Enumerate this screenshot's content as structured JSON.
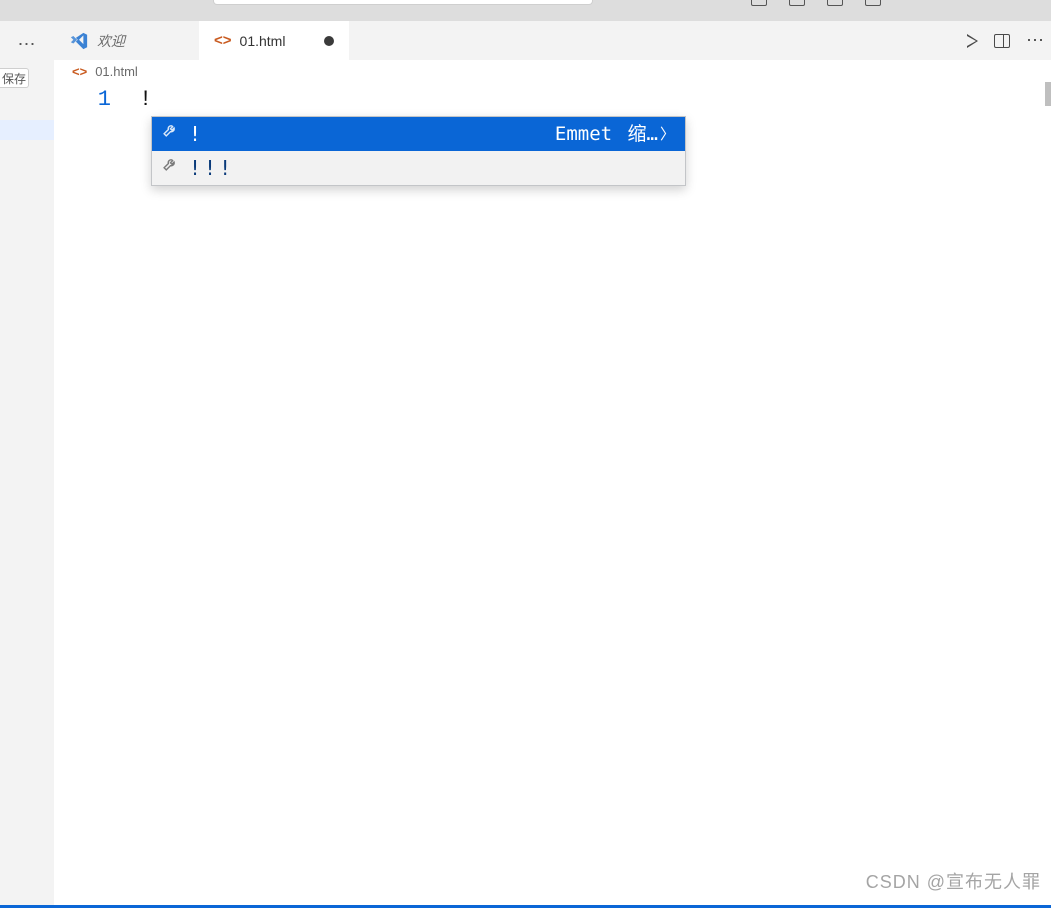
{
  "titlebar": {
    "save_stub": "保存"
  },
  "tabs": {
    "welcome": {
      "label": "欢迎"
    },
    "active": {
      "label": "01.html",
      "dirty": true
    }
  },
  "tab_actions": {
    "run": "Run",
    "split": "Split",
    "more": "…"
  },
  "breadcrumb": {
    "file": "01.html"
  },
  "code": {
    "line_number": "1",
    "content": "!"
  },
  "suggest": {
    "items": [
      {
        "label": "!",
        "hint_left": "Emmet",
        "hint_right": "缩…",
        "selected": true
      },
      {
        "label": "!!!",
        "hint_left": "",
        "hint_right": "",
        "selected": false
      }
    ]
  },
  "watermark": "CSDN @宣布无人罪"
}
